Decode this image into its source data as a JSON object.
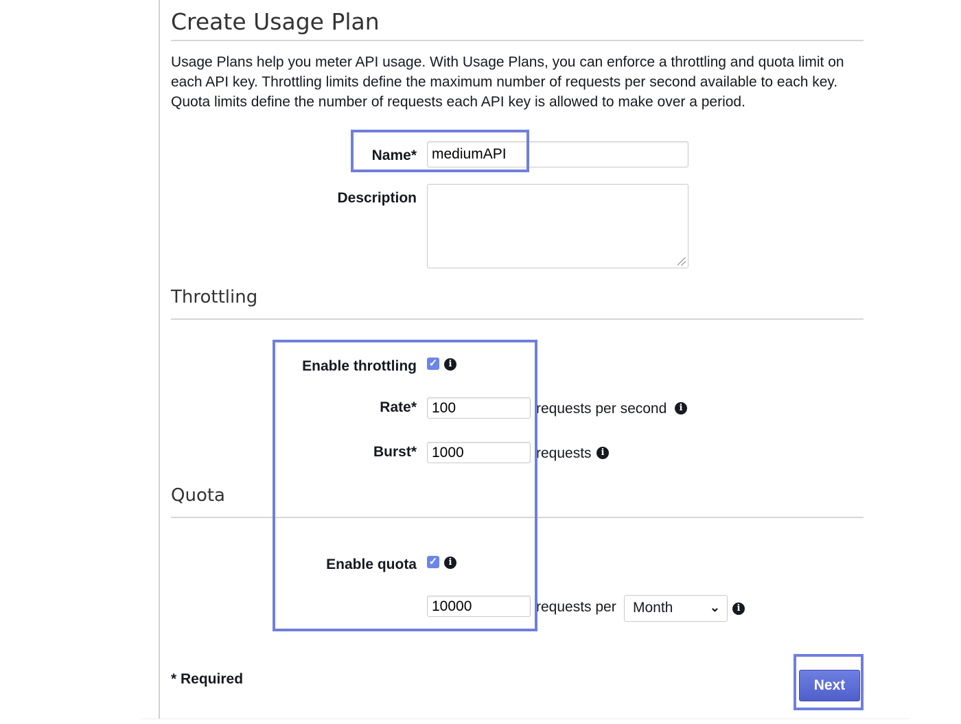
{
  "page": {
    "title": "Create Usage Plan",
    "intro_line1": "Usage Plans help you meter API usage. With Usage Plans, you can enforce a throttling and quota limit on",
    "intro_line2": "each API key. Throttling limits define the maximum number of requests per second available to each key.",
    "intro_line3": "Quota limits define the number of requests each API key is allowed to make over a period."
  },
  "form": {
    "name_label": "Name*",
    "name_value": "mediumAPI",
    "description_label": "Description",
    "description_value": ""
  },
  "throttling": {
    "heading": "Throttling",
    "enable_label": "Enable throttling",
    "enabled": true,
    "rate_label": "Rate*",
    "rate_value": "100",
    "rate_suffix": "requests per second",
    "burst_label": "Burst*",
    "burst_value": "1000",
    "burst_suffix": "requests"
  },
  "quota": {
    "heading": "Quota",
    "enable_label": "Enable quota",
    "enabled": true,
    "value": "10000",
    "suffix": "requests per",
    "period": "Month"
  },
  "footer": {
    "required_note": "* Required",
    "next_label": "Next"
  },
  "icons": {
    "checkbox": "checkbox-checked-icon",
    "info": "info-icon",
    "chevron": "chevron-down-icon",
    "resize": "resize-handle-icon"
  },
  "colors": {
    "highlight": "#6f7fdc",
    "checkbox": "#6b86e8",
    "button": "#5a6bd6"
  }
}
